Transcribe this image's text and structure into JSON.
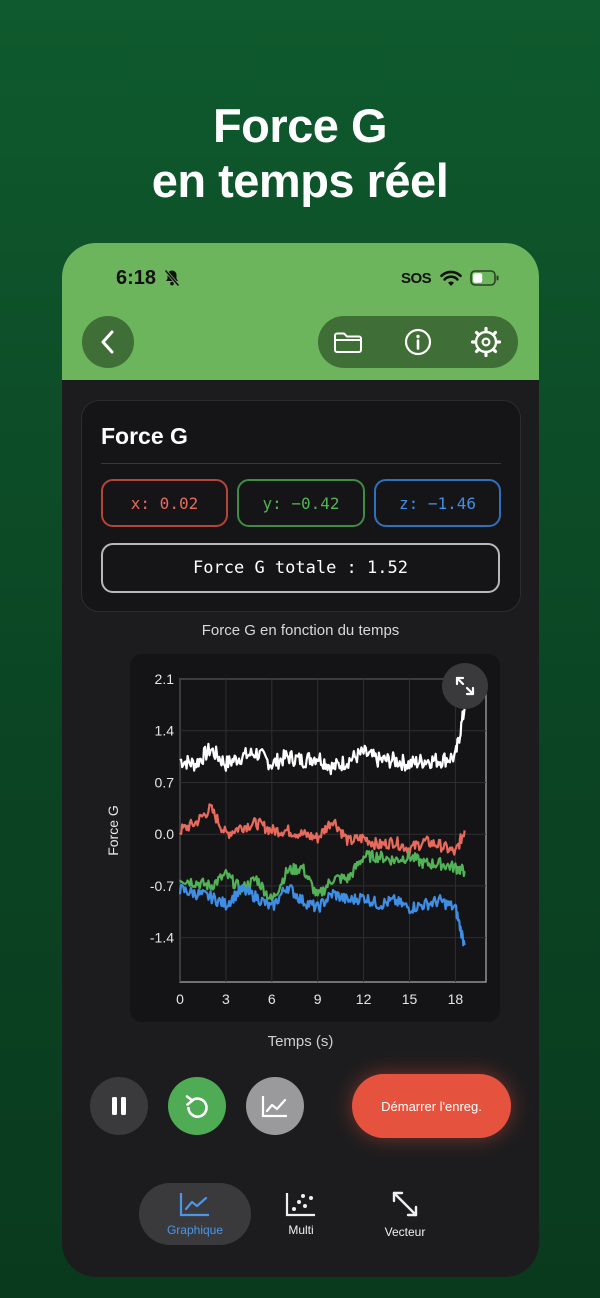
{
  "headline": {
    "line1": "Force G",
    "line2": "en temps réel"
  },
  "status_bar": {
    "time": "6:18",
    "carrier": "SOS"
  },
  "card": {
    "title": "Force G",
    "x_value": "x: 0.02",
    "y_value": "y: −0.42",
    "z_value": "z: −1.46",
    "total": "Force G totale : 1.52"
  },
  "chart_data": {
    "type": "line",
    "title": "Force G en fonction du temps",
    "xlabel": "Temps (s)",
    "ylabel": "Force G",
    "xlim": [
      0,
      20
    ],
    "ylim": [
      -2.0,
      2.1
    ],
    "x_ticks": [
      "0",
      "3",
      "6",
      "9",
      "12",
      "15",
      "18"
    ],
    "y_ticks": [
      "2.1",
      "1.4",
      "0.7",
      "0.0",
      "-0.7",
      "-1.4"
    ],
    "grid": true,
    "series": [
      {
        "color": "#ffffff",
        "x": [
          0,
          1,
          2,
          3,
          4,
          5,
          6,
          7,
          8,
          9,
          10,
          11,
          12,
          13,
          14,
          15,
          16,
          17,
          18,
          18.6
        ],
        "values": [
          1.0,
          0.95,
          1.15,
          0.95,
          1.05,
          1.1,
          0.95,
          1.05,
          1.0,
          1.05,
          0.9,
          1.0,
          1.1,
          1.0,
          1.0,
          0.95,
          1.0,
          1.0,
          1.05,
          1.7
        ]
      },
      {
        "color": "#e86a5c",
        "x": [
          0,
          1,
          2,
          3,
          4,
          5,
          6,
          7,
          8,
          9,
          10,
          11,
          12,
          13,
          14,
          15,
          16,
          17,
          18,
          18.6
        ],
        "values": [
          0.05,
          0.15,
          0.35,
          0.0,
          0.1,
          0.15,
          0.05,
          0.05,
          0.0,
          -0.05,
          0.2,
          -0.1,
          -0.05,
          -0.15,
          -0.1,
          -0.2,
          -0.1,
          -0.15,
          -0.25,
          0.05
        ]
      },
      {
        "color": "#52b356",
        "x": [
          0,
          1,
          2,
          3,
          4,
          5,
          6,
          7,
          8,
          9,
          10,
          11,
          12,
          13,
          14,
          15,
          16,
          17,
          18,
          18.6
        ],
        "values": [
          -0.6,
          -0.65,
          -0.7,
          -0.55,
          -0.75,
          -0.6,
          -0.9,
          -0.5,
          -0.45,
          -0.85,
          -0.6,
          -0.6,
          -0.3,
          -0.3,
          -0.35,
          -0.3,
          -0.4,
          -0.4,
          -0.45,
          -0.5
        ]
      },
      {
        "color": "#3f8ee6",
        "x": [
          0,
          1,
          2,
          3,
          4,
          5,
          6,
          7,
          8,
          9,
          10,
          11,
          12,
          13,
          14,
          15,
          16,
          17,
          18,
          18.6
        ],
        "values": [
          -0.75,
          -0.8,
          -0.85,
          -0.95,
          -0.75,
          -0.85,
          -1.0,
          -0.7,
          -0.9,
          -1.0,
          -0.8,
          -0.9,
          -0.85,
          -0.95,
          -0.9,
          -1.0,
          -0.95,
          -0.9,
          -1.0,
          -1.5
        ]
      }
    ]
  },
  "controls": {
    "record_label": "Démarrer l'enreg."
  },
  "tabs": [
    {
      "label": "Graphique",
      "icon": "line-chart-icon",
      "active": true
    },
    {
      "label": "Multi",
      "icon": "scatter-icon",
      "active": false
    },
    {
      "label": "Vecteur",
      "icon": "diagonal-arrows-icon",
      "active": false
    }
  ],
  "colors": {
    "accent_green": "#6db55c",
    "x_color": "#e86a5c",
    "y_color": "#52b356",
    "z_color": "#3f8ee6",
    "record": "#e5533f",
    "tab_active": "#4a97ea"
  }
}
